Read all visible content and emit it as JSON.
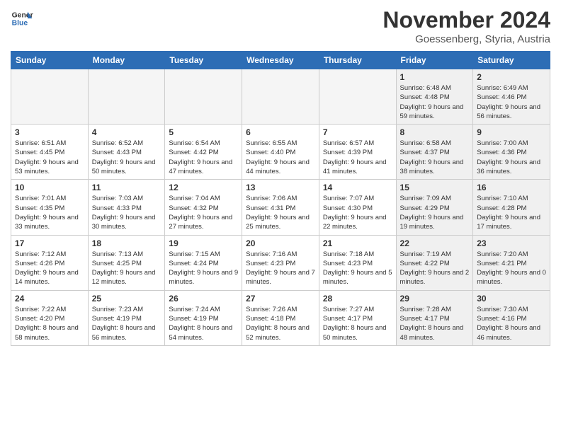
{
  "header": {
    "logo_line1": "General",
    "logo_line2": "Blue",
    "month": "November 2024",
    "location": "Goessenberg, Styria, Austria"
  },
  "weekdays": [
    "Sunday",
    "Monday",
    "Tuesday",
    "Wednesday",
    "Thursday",
    "Friday",
    "Saturday"
  ],
  "weeks": [
    [
      {
        "day": "",
        "info": "",
        "empty": true
      },
      {
        "day": "",
        "info": "",
        "empty": true
      },
      {
        "day": "",
        "info": "",
        "empty": true
      },
      {
        "day": "",
        "info": "",
        "empty": true
      },
      {
        "day": "",
        "info": "",
        "empty": true
      },
      {
        "day": "1",
        "info": "Sunrise: 6:48 AM\nSunset: 4:48 PM\nDaylight: 9 hours and 59 minutes.",
        "shaded": true
      },
      {
        "day": "2",
        "info": "Sunrise: 6:49 AM\nSunset: 4:46 PM\nDaylight: 9 hours and 56 minutes.",
        "shaded": true
      }
    ],
    [
      {
        "day": "3",
        "info": "Sunrise: 6:51 AM\nSunset: 4:45 PM\nDaylight: 9 hours and 53 minutes.",
        "shaded": false
      },
      {
        "day": "4",
        "info": "Sunrise: 6:52 AM\nSunset: 4:43 PM\nDaylight: 9 hours and 50 minutes.",
        "shaded": false
      },
      {
        "day": "5",
        "info": "Sunrise: 6:54 AM\nSunset: 4:42 PM\nDaylight: 9 hours and 47 minutes.",
        "shaded": false
      },
      {
        "day": "6",
        "info": "Sunrise: 6:55 AM\nSunset: 4:40 PM\nDaylight: 9 hours and 44 minutes.",
        "shaded": false
      },
      {
        "day": "7",
        "info": "Sunrise: 6:57 AM\nSunset: 4:39 PM\nDaylight: 9 hours and 41 minutes.",
        "shaded": false
      },
      {
        "day": "8",
        "info": "Sunrise: 6:58 AM\nSunset: 4:37 PM\nDaylight: 9 hours and 38 minutes.",
        "shaded": true
      },
      {
        "day": "9",
        "info": "Sunrise: 7:00 AM\nSunset: 4:36 PM\nDaylight: 9 hours and 36 minutes.",
        "shaded": true
      }
    ],
    [
      {
        "day": "10",
        "info": "Sunrise: 7:01 AM\nSunset: 4:35 PM\nDaylight: 9 hours and 33 minutes.",
        "shaded": false
      },
      {
        "day": "11",
        "info": "Sunrise: 7:03 AM\nSunset: 4:33 PM\nDaylight: 9 hours and 30 minutes.",
        "shaded": false
      },
      {
        "day": "12",
        "info": "Sunrise: 7:04 AM\nSunset: 4:32 PM\nDaylight: 9 hours and 27 minutes.",
        "shaded": false
      },
      {
        "day": "13",
        "info": "Sunrise: 7:06 AM\nSunset: 4:31 PM\nDaylight: 9 hours and 25 minutes.",
        "shaded": false
      },
      {
        "day": "14",
        "info": "Sunrise: 7:07 AM\nSunset: 4:30 PM\nDaylight: 9 hours and 22 minutes.",
        "shaded": false
      },
      {
        "day": "15",
        "info": "Sunrise: 7:09 AM\nSunset: 4:29 PM\nDaylight: 9 hours and 19 minutes.",
        "shaded": true
      },
      {
        "day": "16",
        "info": "Sunrise: 7:10 AM\nSunset: 4:28 PM\nDaylight: 9 hours and 17 minutes.",
        "shaded": true
      }
    ],
    [
      {
        "day": "17",
        "info": "Sunrise: 7:12 AM\nSunset: 4:26 PM\nDaylight: 9 hours and 14 minutes.",
        "shaded": false
      },
      {
        "day": "18",
        "info": "Sunrise: 7:13 AM\nSunset: 4:25 PM\nDaylight: 9 hours and 12 minutes.",
        "shaded": false
      },
      {
        "day": "19",
        "info": "Sunrise: 7:15 AM\nSunset: 4:24 PM\nDaylight: 9 hours and 9 minutes.",
        "shaded": false
      },
      {
        "day": "20",
        "info": "Sunrise: 7:16 AM\nSunset: 4:23 PM\nDaylight: 9 hours and 7 minutes.",
        "shaded": false
      },
      {
        "day": "21",
        "info": "Sunrise: 7:18 AM\nSunset: 4:23 PM\nDaylight: 9 hours and 5 minutes.",
        "shaded": false
      },
      {
        "day": "22",
        "info": "Sunrise: 7:19 AM\nSunset: 4:22 PM\nDaylight: 9 hours and 2 minutes.",
        "shaded": true
      },
      {
        "day": "23",
        "info": "Sunrise: 7:20 AM\nSunset: 4:21 PM\nDaylight: 9 hours and 0 minutes.",
        "shaded": true
      }
    ],
    [
      {
        "day": "24",
        "info": "Sunrise: 7:22 AM\nSunset: 4:20 PM\nDaylight: 8 hours and 58 minutes.",
        "shaded": false
      },
      {
        "day": "25",
        "info": "Sunrise: 7:23 AM\nSunset: 4:19 PM\nDaylight: 8 hours and 56 minutes.",
        "shaded": false
      },
      {
        "day": "26",
        "info": "Sunrise: 7:24 AM\nSunset: 4:19 PM\nDaylight: 8 hours and 54 minutes.",
        "shaded": false
      },
      {
        "day": "27",
        "info": "Sunrise: 7:26 AM\nSunset: 4:18 PM\nDaylight: 8 hours and 52 minutes.",
        "shaded": false
      },
      {
        "day": "28",
        "info": "Sunrise: 7:27 AM\nSunset: 4:17 PM\nDaylight: 8 hours and 50 minutes.",
        "shaded": false
      },
      {
        "day": "29",
        "info": "Sunrise: 7:28 AM\nSunset: 4:17 PM\nDaylight: 8 hours and 48 minutes.",
        "shaded": true
      },
      {
        "day": "30",
        "info": "Sunrise: 7:30 AM\nSunset: 4:16 PM\nDaylight: 8 hours and 46 minutes.",
        "shaded": true
      }
    ]
  ]
}
